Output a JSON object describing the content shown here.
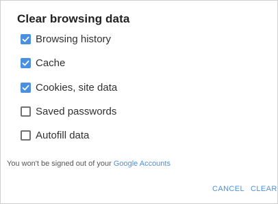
{
  "dialog": {
    "title": "Clear browsing data",
    "options": [
      {
        "label": "Browsing history",
        "checked": true
      },
      {
        "label": "Cache",
        "checked": true
      },
      {
        "label": "Cookies, site data",
        "checked": true
      },
      {
        "label": "Saved passwords",
        "checked": false
      },
      {
        "label": "Autofill data",
        "checked": false
      }
    ],
    "note_text": "You won't be signed out of your ",
    "note_link": "Google Accounts",
    "cancel_label": "CANCEL",
    "clear_label": "CLEAR"
  },
  "colors": {
    "accent": "#4a90e2",
    "checkbox_checked": "#4a8fe0",
    "checkbox_unchecked_border": "#6f6f6f",
    "title_text": "#212121",
    "body_text": "#303030",
    "note_text": "#555555"
  },
  "icons": {
    "checked": "checkbox-checked-icon",
    "unchecked": "checkbox-unchecked-icon"
  }
}
